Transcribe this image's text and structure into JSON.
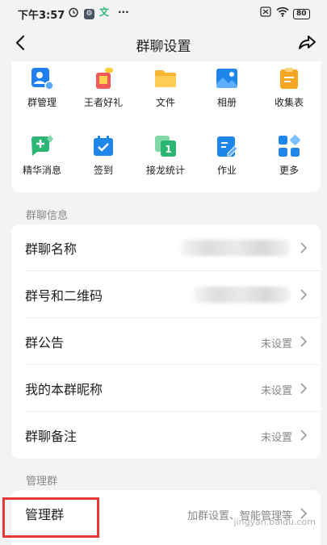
{
  "status_bar": {
    "time": "下午3:57",
    "more": "···",
    "battery": "80",
    "app_icon_a": "⚙",
    "app_icon_b": "文"
  },
  "nav": {
    "title": "群聊设置"
  },
  "apps": [
    {
      "label": "群管理",
      "icon": "group-manage-icon",
      "color": "#1f7ef0"
    },
    {
      "label": "王者好礼",
      "icon": "gift-icon",
      "color": "#f0595a"
    },
    {
      "label": "文件",
      "icon": "folder-icon",
      "color": "#f7b733"
    },
    {
      "label": "相册",
      "icon": "album-icon",
      "color": "#1e86e8"
    },
    {
      "label": "收集表",
      "icon": "clipboard-icon",
      "color": "#f5a623"
    },
    {
      "label": "精华消息",
      "icon": "chat-gem-icon",
      "color": "#2bb673"
    },
    {
      "label": "签到",
      "icon": "calendar-check-icon",
      "color": "#1e86e8"
    },
    {
      "label": "接龙统计",
      "icon": "relay-icon",
      "color": "#2bb673"
    },
    {
      "label": "作业",
      "icon": "homework-icon",
      "color": "#1e86e8"
    },
    {
      "label": "更多",
      "icon": "grid-more-icon",
      "color": "#1e86e8"
    }
  ],
  "group_info": {
    "section_title": "群聊信息",
    "rows": [
      {
        "label": "群聊名称",
        "value": ""
      },
      {
        "label": "群号和二维码",
        "value": ""
      },
      {
        "label": "群公告",
        "value": "未设置"
      },
      {
        "label": "我的本群昵称",
        "value": "未设置"
      },
      {
        "label": "群聊备注",
        "value": "未设置"
      }
    ]
  },
  "manage": {
    "section_title": "管理群",
    "row": {
      "label": "管理群",
      "value": "加群设置、智能管理等"
    }
  },
  "watermark": "jingyan.baidu.com",
  "colors": {
    "highlight": "#e53935",
    "background": "#f2f3f5"
  }
}
